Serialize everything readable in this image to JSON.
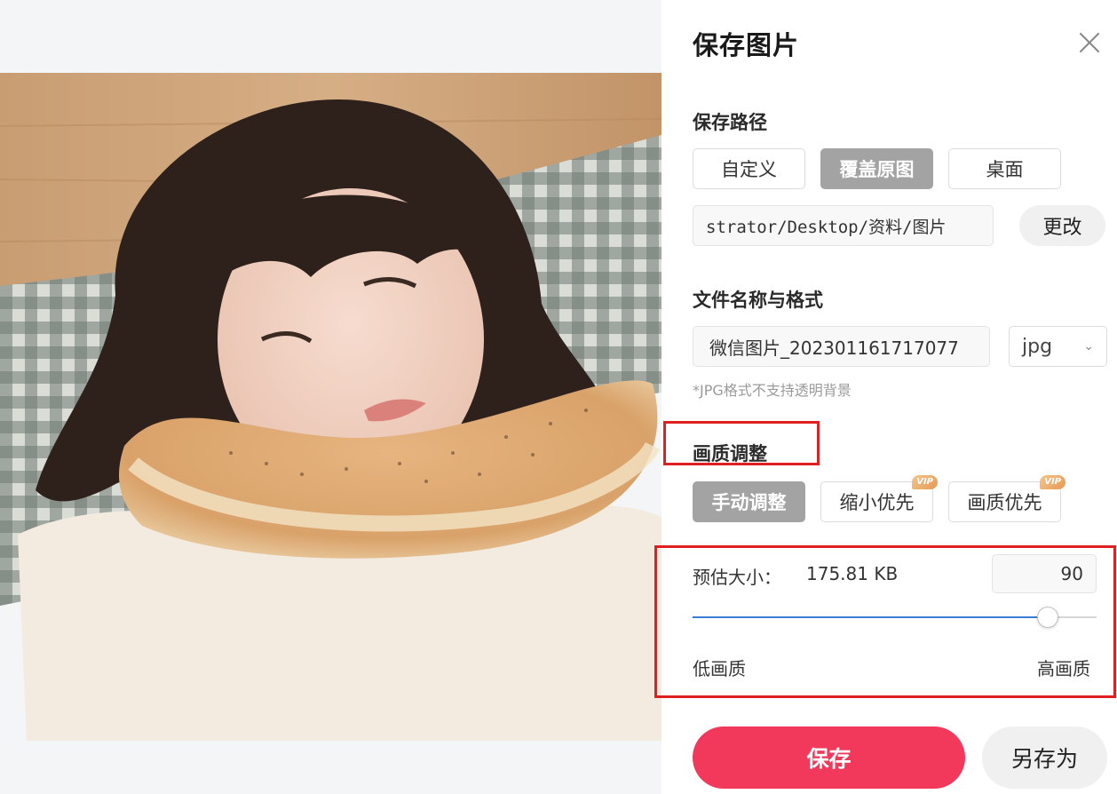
{
  "dialog": {
    "title": "保存图片",
    "close_icon": "close-icon"
  },
  "save_path": {
    "label": "保存路径",
    "options": [
      "自定义",
      "覆盖原图",
      "桌面"
    ],
    "selected": "覆盖原图",
    "path_value": "strator/Desktop/资料/图片",
    "change_label": "更改"
  },
  "file": {
    "label": "文件名称与格式",
    "name_value": "微信图片_20230116171707​7",
    "format_value": "jpg",
    "format_chevron": "chevron-down-icon",
    "hint": "*JPG格式不支持透明背景"
  },
  "quality": {
    "label": "画质调整",
    "modes": [
      {
        "label": "手动调整",
        "vip": ""
      },
      {
        "label": "缩小优先",
        "vip": "VIP"
      },
      {
        "label": "画质优先",
        "vip": "VIP"
      }
    ],
    "selected": "手动调整",
    "estimate_label": "预估大小：",
    "estimate_value": "175.81 KB",
    "value": "90",
    "slider_fraction": 0.88,
    "low_label": "低画质",
    "high_label": "高画质"
  },
  "actions": {
    "save_label": "保存",
    "save_as_label": "另存为"
  },
  "colors": {
    "accent": "#f2395b",
    "highlight_box": "#e02020",
    "slider_fill": "#3a7bd5",
    "active_option": "#a3a3a3"
  }
}
